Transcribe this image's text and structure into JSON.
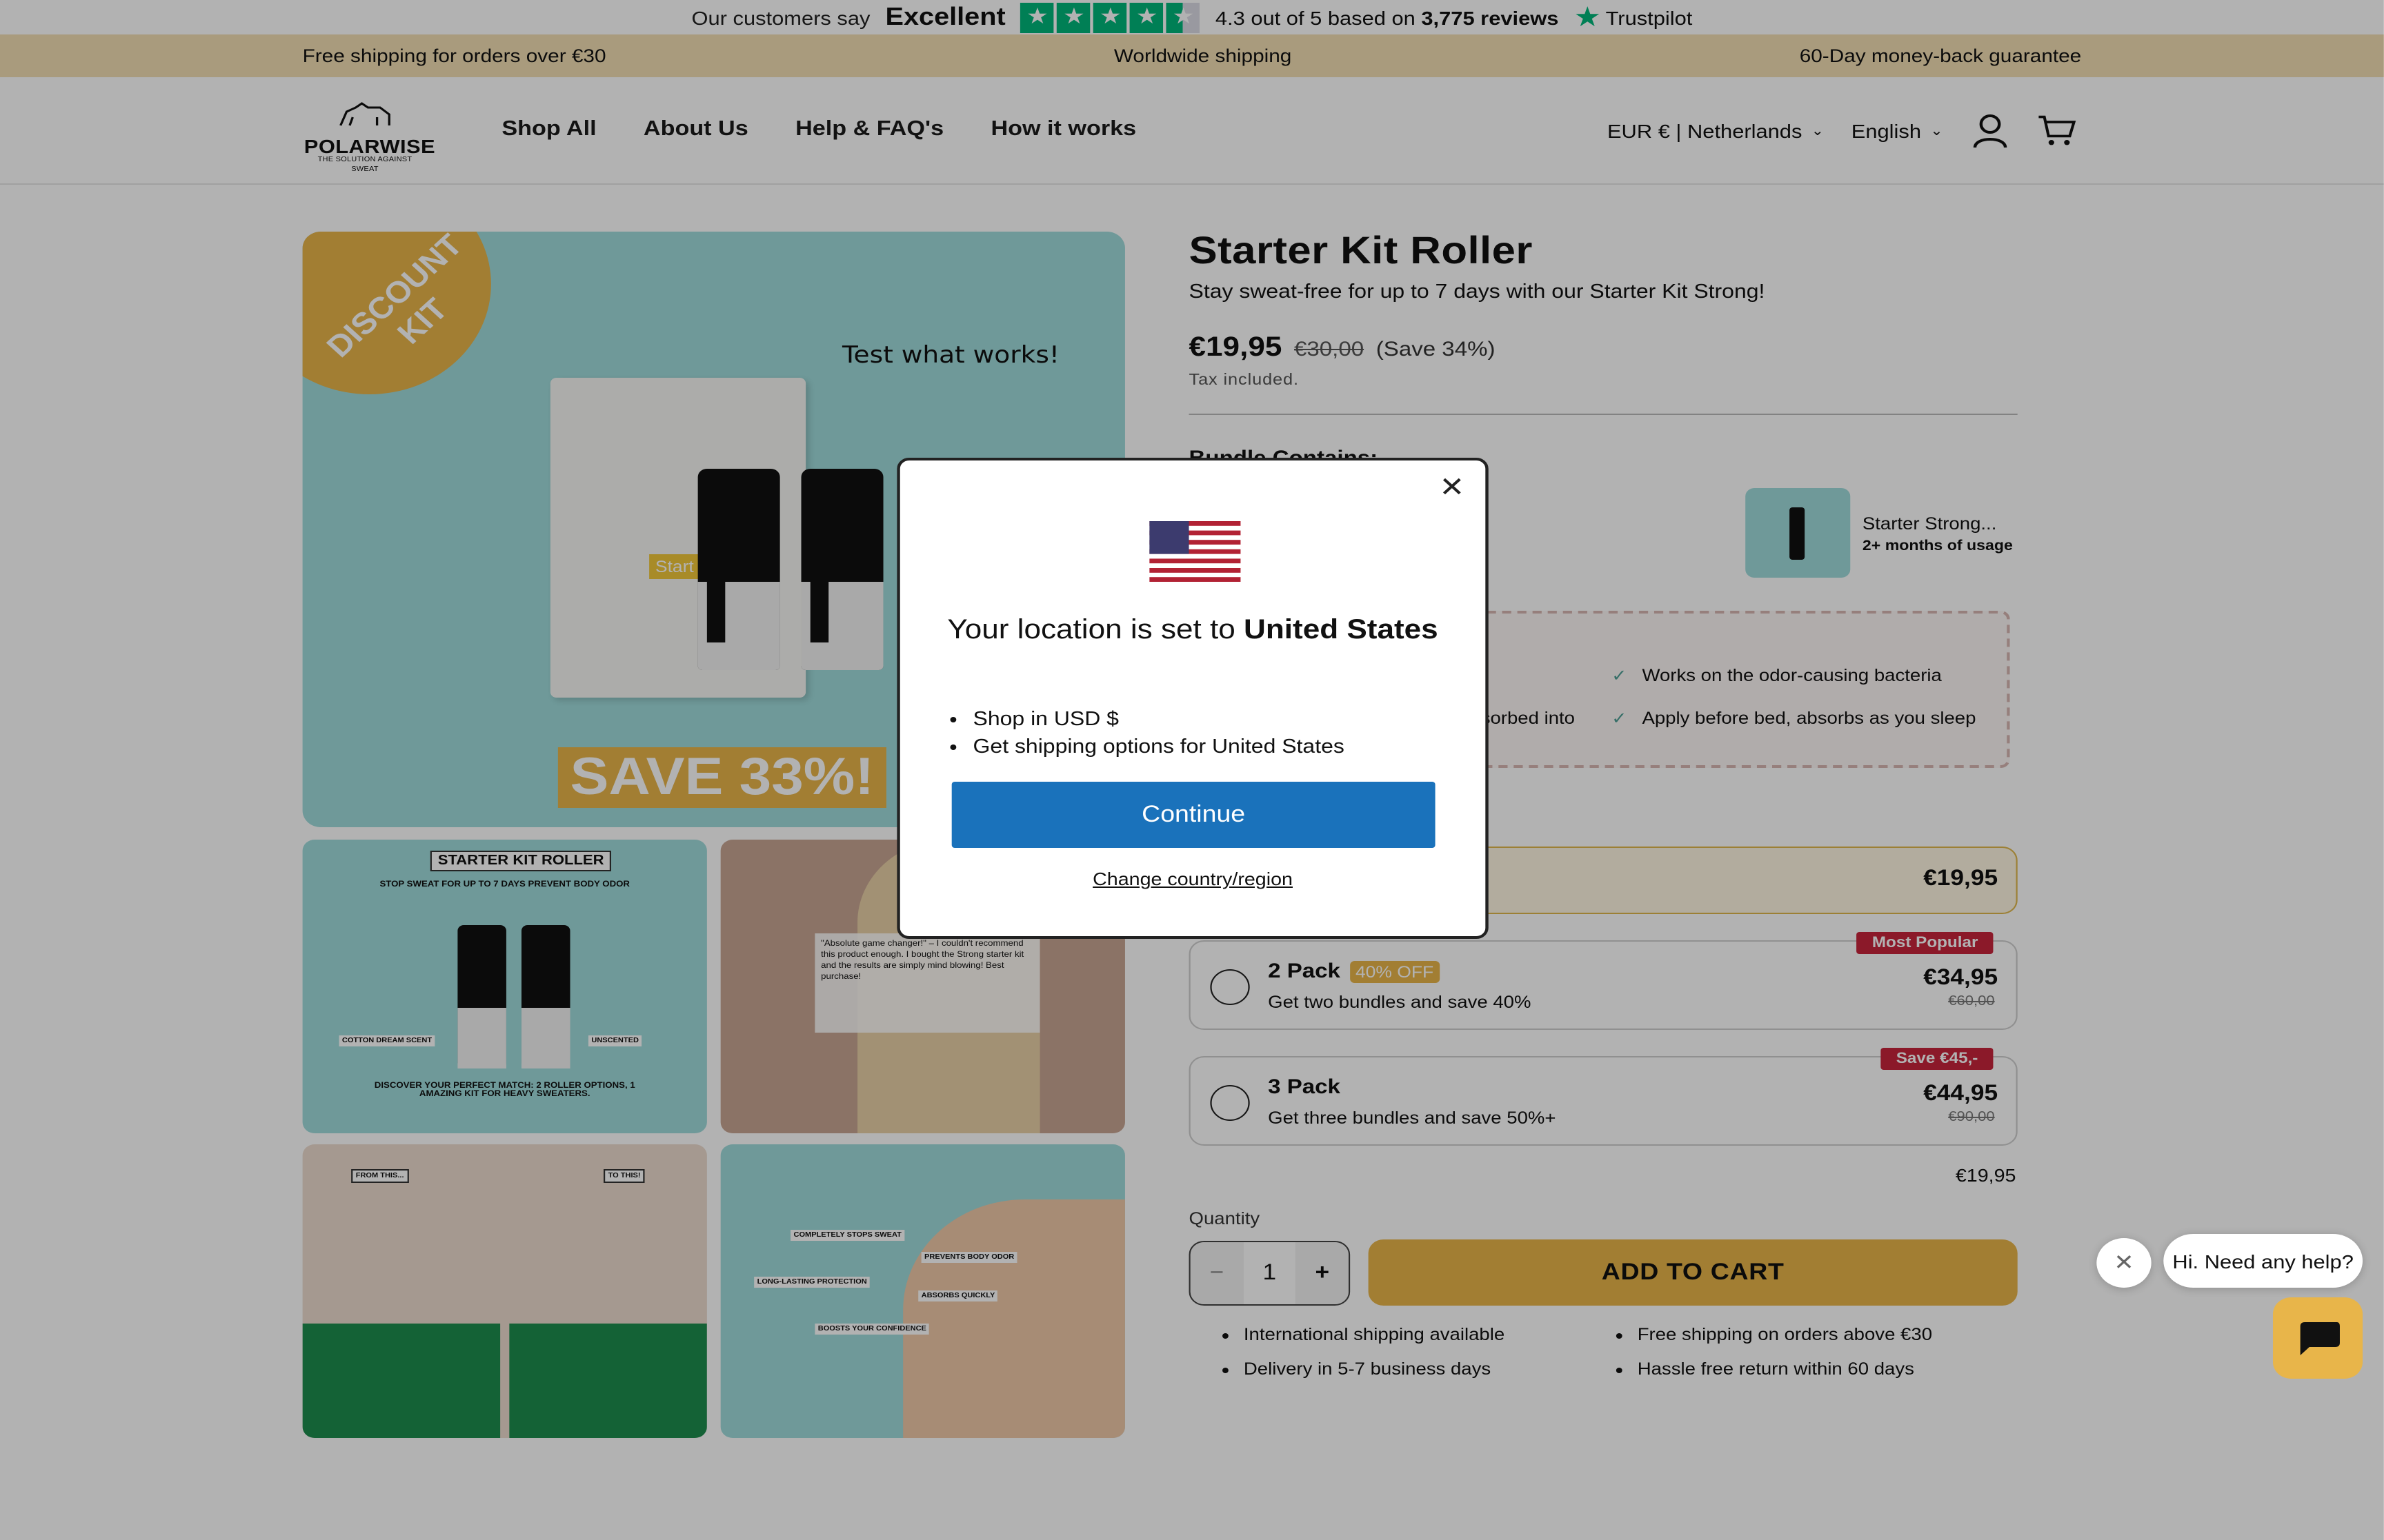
{
  "trustpilot": {
    "lead": "Our customers say",
    "rating_word": "Excellent",
    "stars_filled": 4.5,
    "summary_prefix": "4.3 out of 5 based on",
    "review_count": "3,775 reviews",
    "brand": "Trustpilot"
  },
  "announcement": {
    "left": "Free shipping for orders over €30",
    "center": "Worldwide shipping",
    "right": "60-Day money-back guarantee"
  },
  "header": {
    "logo_name": "POLARWISE",
    "logo_tagline": "THE SOLUTION AGAINST SWEAT",
    "nav": [
      "Shop All",
      "About Us",
      "Help & FAQ's",
      "How it works"
    ],
    "currency": "EUR € | Netherlands",
    "language": "English"
  },
  "gallery": {
    "badge": "DISCOUNT KIT",
    "tagline": "Test what works!",
    "box_label": "Start",
    "save_banner": "SAVE 33%!",
    "thumb1_title": "STARTER KIT ROLLER",
    "thumb1_sub": "STOP SWEAT FOR UP TO 7 DAYS PREVENT BODY ODOR",
    "thumb1_left": "COTTON DREAM SCENT",
    "thumb1_right": "UNSCENTED",
    "thumb1_footer": "DISCOVER YOUR PERFECT MATCH: 2 ROLLER OPTIONS, 1 AMAZING KIT FOR HEAVY SWEATERS.",
    "thumb2_review": "\"Absolute game changer!\" – I couldn't recommend this product enough. I bought the Strong starter kit and the results are simply mind blowing! Best purchase!",
    "thumb3_from": "FROM THIS...",
    "thumb3_to": "TO THIS!",
    "thumb4_tags": [
      "COMPLETELY STOPS SWEAT",
      "PREVENTS BODY ODOR",
      "LONG-LASTING PROTECTION",
      "ABSORBS QUICKLY",
      "BOOSTS YOUR CONFIDENCE"
    ]
  },
  "product": {
    "title": "Starter Kit Roller",
    "subtitle": "Stay sweat-free for up to 7 days with our Starter Kit Strong!",
    "price": "€19,95",
    "price_old": "€30,00",
    "save": "(Save 34%)",
    "tax": "Tax included.",
    "bundle_heading": "Bundle Contains:",
    "bundle_item_name": "Starter Strong...",
    "bundle_item_usage": "2+ months of usage",
    "features": [
      "Works on the odor-causing bacteria",
      "Apply before bed, absorbs as you sleep",
      "sorbed into"
    ],
    "options": [
      {
        "price": "€19,95"
      },
      {
        "name": "2 Pack",
        "tag": "40% OFF",
        "desc": "Get two bundles and save 40%",
        "price": "€34,95",
        "old": "€60,00",
        "ribbon": "Most Popular"
      },
      {
        "name": "3 Pack",
        "desc": "Get three bundles and save 50%+",
        "price": "€44,95",
        "old": "€90,00",
        "ribbon": "Save €45,-"
      }
    ],
    "total": "€19,95",
    "quantity_label": "Quantity",
    "quantity": "1",
    "add_to_cart": "ADD TO CART",
    "perks_left": [
      "International shipping available",
      "Delivery in 5-7 business days"
    ],
    "perks_right": [
      "Free shipping on orders above €30",
      "Hassle free return within 60 days"
    ]
  },
  "chat": {
    "bubble": "Hi. Need any help?"
  },
  "modal": {
    "title_prefix": "Your location is set to",
    "title_country": "United States",
    "items": [
      "Shop in USD $",
      "Get shipping options for United States"
    ],
    "continue": "Continue",
    "change": "Change country/region"
  },
  "colors": {
    "accent": "#e8b54a",
    "teal": "#9fdbdb",
    "cta_blue": "#1a72bb",
    "ribbon_red": "#c8243b",
    "trustpilot_green": "#00b67a"
  }
}
